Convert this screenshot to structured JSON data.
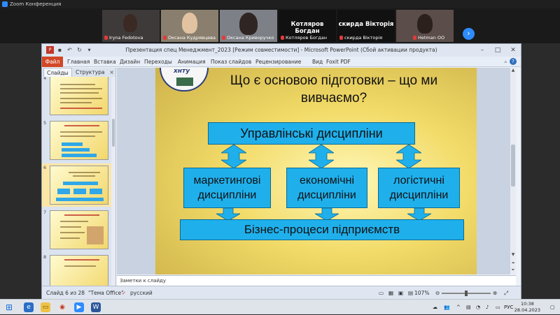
{
  "zoom": {
    "window_title": "Zoom Конференция",
    "participants": [
      {
        "name": "Iryna Fedotova",
        "bg": "#3f3a3a",
        "face": "#3b2a24"
      },
      {
        "name": "Оксана Кудрявцева",
        "bg": "#8a7f6e",
        "face": "#e2c3a1"
      },
      {
        "name": "Оксана Криворучко",
        "bg": "#7d8086",
        "face": "#2f2522"
      },
      {
        "name": "Котляров Богдан",
        "big": "Котляров Богдан"
      },
      {
        "name": "скирда Вікторія",
        "big": "скирда Вікторія"
      },
      {
        "name": "Hetman OO",
        "bg": "#5b4d4a",
        "face": "#2c201c"
      }
    ],
    "next_icon": "chevron-right-icon"
  },
  "ppt": {
    "title": "Презентация спец Менеджмент_2023 [Режим совместимости] - Microsoft PowerPoint (Сбой активации продукта)",
    "file_tab": "Файл",
    "tabs": [
      "Главная",
      "Вставка",
      "Дизайн",
      "Переходы",
      "Анимация",
      "Показ слайдов",
      "Рецензирование",
      "Вид",
      "Foxit PDF"
    ],
    "panel_tabs": {
      "slides": "Слайды",
      "outline": "Структура"
    },
    "thumb_numbers": [
      "4",
      "5",
      "6",
      "7",
      "8"
    ],
    "notes_placeholder": "Заметки к слайду",
    "status": {
      "slide_info": "Слайд 6 из 28",
      "theme": "\"Тема Office\"",
      "language": "русский",
      "zoom": "107%"
    }
  },
  "slide": {
    "title": "Що є основою підготовки – що ми вивчаємо?",
    "logo_text": "хнту",
    "top_box": "Управлінські дисципліни",
    "mid_boxes": [
      "маркетингові дисципліни",
      "економічні дисципліни",
      "логістичні дисципліни"
    ],
    "bottom_box": "Бізнес-процеси підприємств",
    "colors": {
      "box": "#1fb0ec",
      "arrow": "#1fb0ec"
    }
  },
  "taskbar": {
    "language": "РУС",
    "time": "10:38",
    "date": "28.04.2023"
  }
}
